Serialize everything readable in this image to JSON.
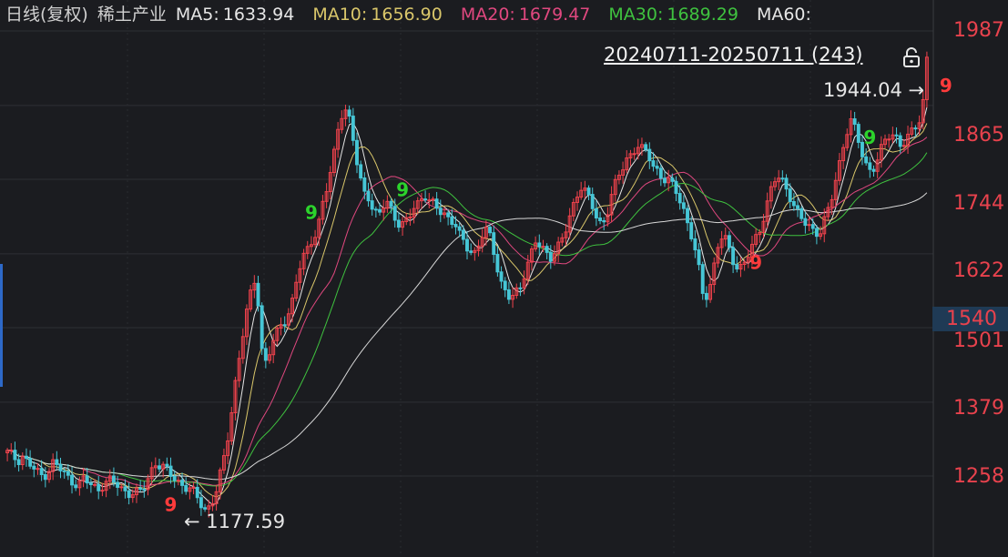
{
  "legend": {
    "period": "日线(复权)",
    "name": "稀土产业",
    "ma5": {
      "label": "MA5:",
      "value": "1633.94",
      "color": "#e6e6e6"
    },
    "ma10": {
      "label": "MA10:",
      "value": "1656.90",
      "color": "#d9c66a"
    },
    "ma20": {
      "label": "MA20:",
      "value": "1679.47",
      "color": "#e0487f"
    },
    "ma30": {
      "label": "MA30:",
      "value": "1689.29",
      "color": "#3fc23f"
    },
    "ma60": {
      "label": "MA60:",
      "value": "",
      "color": "#e6e6e6"
    }
  },
  "range_label": "20240711-20250711 (243)",
  "high_marker": "1944.04",
  "low_marker": "1177.59",
  "current_price": "1540",
  "price_axis": [
    "1987",
    "1865",
    "1744",
    "1622",
    "1501",
    "1379",
    "1258"
  ],
  "colors": {
    "up": "#f0424c",
    "down": "#46c6d6",
    "axis": "#e8424d",
    "bg": "#1b1c20"
  },
  "chart_data": {
    "type": "candlestick",
    "title": "稀土产业",
    "ylim": [
      1160,
      2010
    ],
    "yticks": [
      1987,
      1865,
      1744,
      1622,
      1501,
      1379,
      1258
    ],
    "period": "20240711-20250711",
    "bars": 243,
    "close_path": [
      1295,
      1290,
      1285,
      1292,
      1280,
      1270,
      1262,
      1258,
      1268,
      1280,
      1272,
      1262,
      1255,
      1250,
      1245,
      1252,
      1245,
      1240,
      1238,
      1248,
      1250,
      1245,
      1240,
      1235,
      1232,
      1230,
      1228,
      1240,
      1262,
      1282,
      1275,
      1268,
      1260,
      1255,
      1248,
      1240,
      1235,
      1225,
      1215,
      1205,
      1210,
      1228,
      1262,
      1300,
      1360,
      1420,
      1470,
      1520,
      1560,
      1590,
      1470,
      1440,
      1470,
      1490,
      1510,
      1520,
      1540,
      1580,
      1610,
      1630,
      1650,
      1660,
      1700,
      1730,
      1770,
      1830,
      1858,
      1852,
      1810,
      1760,
      1730,
      1720,
      1690,
      1680,
      1700,
      1710,
      1690,
      1670,
      1665,
      1680,
      1700,
      1710,
      1720,
      1705,
      1700,
      1695,
      1690,
      1680,
      1670,
      1650,
      1640,
      1630,
      1625,
      1640,
      1660,
      1650,
      1620,
      1580,
      1560,
      1545,
      1555,
      1570,
      1600,
      1620,
      1640,
      1630,
      1625,
      1620,
      1630,
      1640,
      1660,
      1690,
      1720,
      1735,
      1720,
      1700,
      1680,
      1670,
      1690,
      1720,
      1740,
      1760,
      1780,
      1790,
      1800,
      1790,
      1785,
      1770,
      1760,
      1745,
      1740,
      1730,
      1720,
      1700,
      1670,
      1640,
      1600,
      1550,
      1560,
      1600,
      1640,
      1650,
      1630,
      1610,
      1600,
      1605,
      1620,
      1640,
      1660,
      1690,
      1720,
      1740,
      1745,
      1735,
      1720,
      1700,
      1680,
      1670,
      1665,
      1660,
      1660,
      1680,
      1700,
      1740,
      1780,
      1820,
      1840,
      1820,
      1790,
      1770,
      1760,
      1770,
      1790,
      1810,
      1820,
      1815,
      1800,
      1805,
      1820,
      1835,
      1850,
      1944
    ],
    "ma_series": [
      {
        "name": "MA5",
        "last": 1633.94
      },
      {
        "name": "MA10",
        "last": 1656.9
      },
      {
        "name": "MA20",
        "last": 1679.47
      },
      {
        "name": "MA30",
        "last": 1689.29
      },
      {
        "name": "MA60",
        "last": null
      }
    ],
    "high": 1944.04,
    "low": 1177.59,
    "current": 1540,
    "seq_markers": [
      {
        "idx": 32,
        "text": "9",
        "color": "#ff3b3b"
      },
      {
        "idx": 60,
        "text": "9",
        "color": "#2cd32c"
      },
      {
        "idx": 78,
        "text": "9",
        "color": "#2cd32c"
      },
      {
        "idx": 147,
        "text": "9",
        "color": "#ff3b3b"
      },
      {
        "idx": 170,
        "text": "9",
        "color": "#2cd32c"
      },
      {
        "idx": 185,
        "text": "9",
        "color": "#ff3b3b"
      },
      {
        "idx": 200,
        "text": "9",
        "color": "#2cd32c"
      }
    ]
  }
}
